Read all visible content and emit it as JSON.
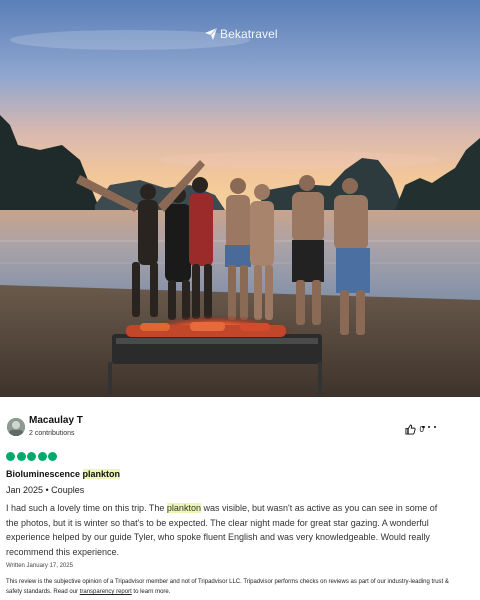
{
  "watermark": {
    "brand": "Bekatravel"
  },
  "review": {
    "user": {
      "name": "Macaulay T",
      "contributions": "2 contributions"
    },
    "helpful_count": "0",
    "rating": 5,
    "title_prefix": "Bioluminescence ",
    "title_highlight": "plankton",
    "date_line": "Jan 2025 • Couples",
    "body_before": "I had such a lovely time on this trip. The ",
    "body_highlight": "plankton",
    "body_after": " was visible, but wasn't as active as you can see in some of the photos, but it is winter so that's to be expected. The clear night made for great star gazing. A wonderful experience helped by our guide Tyler, who spoke fluent English and was very knowledgeable. Would really recommend this experience.",
    "written": "Written January 17, 2025",
    "disclaimer_before": "This review is the subjective opinion of a Tripadvisor member and not of Tripadvisor LLC. Tripadvisor performs checks on reviews as part of our industry-leading trust & safety standards. Read our ",
    "disclaimer_link": "transparency report",
    "disclaimer_after": " to learn more."
  },
  "colors": {
    "rating_green": "#00aa6c",
    "highlight": "#eef5b8"
  }
}
